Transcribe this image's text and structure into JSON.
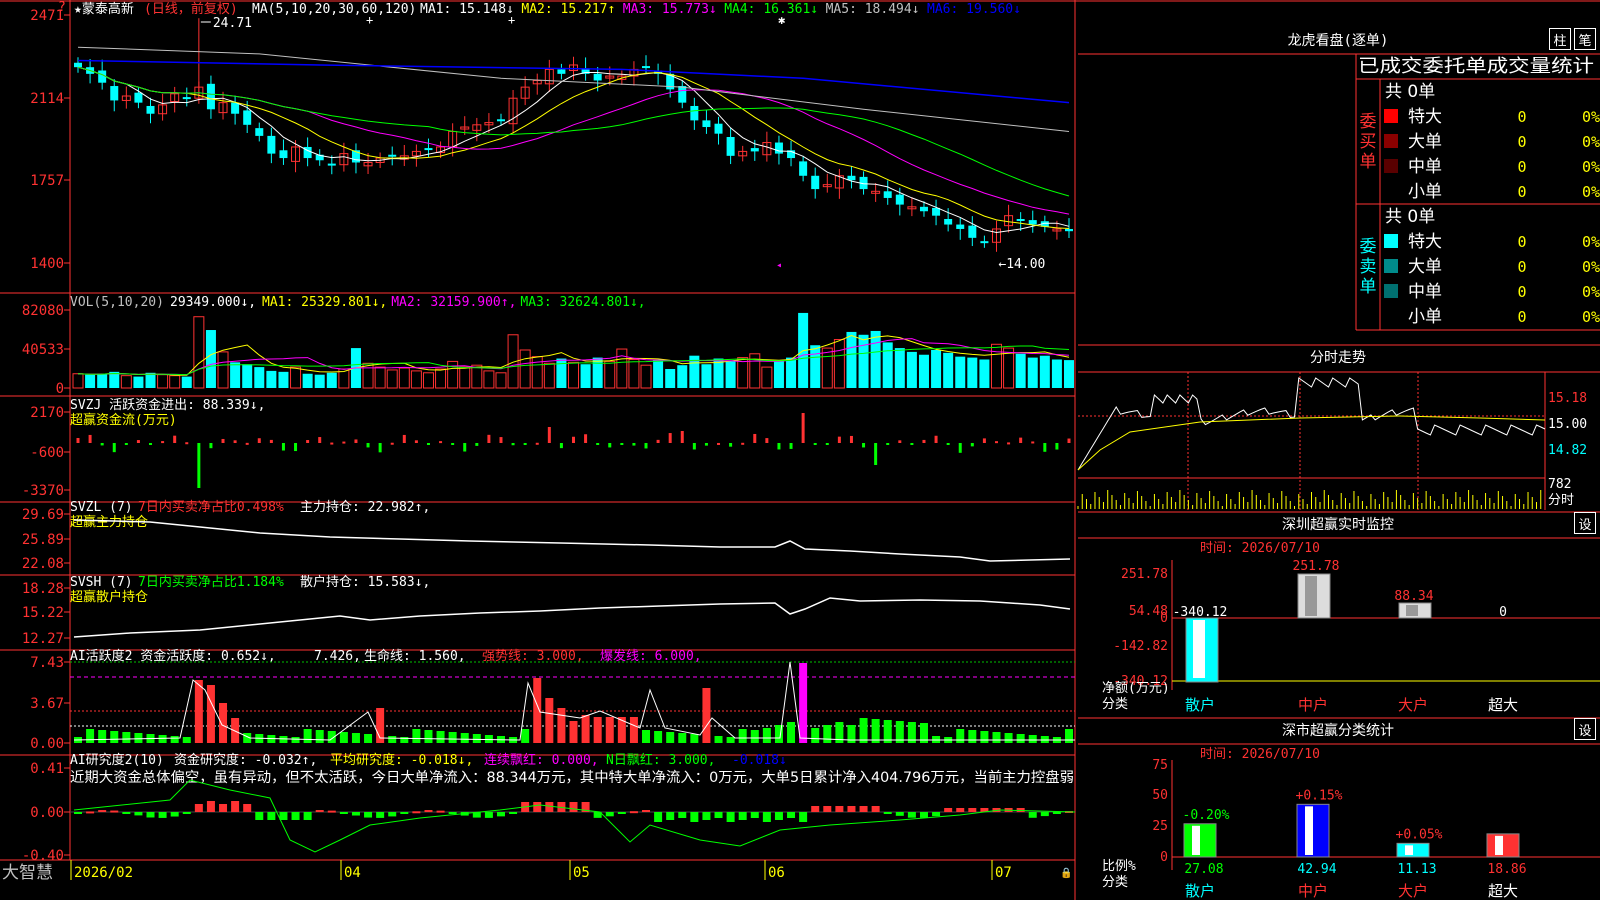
{
  "app": {
    "brand": "大智慧",
    "close_glyph": "?",
    "lock_glyph": "🔒"
  },
  "main": {
    "stock_name": "★蒙泰高新",
    "stock_mode": "(日线，前复权)",
    "ma_header": "MA(5,10,20,30,60,120)",
    "ma": [
      {
        "label": "MA1: 15.148",
        "arrow": "↓",
        "color": "#ffffff"
      },
      {
        "label": "MA2: 15.217",
        "arrow": "↑",
        "color": "#ffff00"
      },
      {
        "label": "MA3: 15.773",
        "arrow": "↓",
        "color": "#ff00ff"
      },
      {
        "label": "MA4: 16.361",
        "arrow": "↓",
        "color": "#00ff00"
      },
      {
        "label": "MA5: 18.494",
        "arrow": "↓",
        "color": "#c0c0c0"
      },
      {
        "label": "MA6: 19.560",
        "arrow": "↓",
        "color": "#0000ff"
      }
    ],
    "price_ticks": [
      "2471",
      "2114",
      "1757",
      "1400"
    ],
    "high_label": "24.71",
    "low_label": "←14.00"
  },
  "vol": {
    "header": "VOL(5,10,20)",
    "value": "29349.000",
    "ma": [
      {
        "label": "MA1: 25329.801",
        "arrow": "↓",
        "color": "#ffff00"
      },
      {
        "label": "MA2: 32159.900",
        "arrow": "↑",
        "color": "#ff00ff"
      },
      {
        "label": "MA3: 32624.801",
        "arrow": "↓",
        "color": "#00ff00"
      }
    ],
    "ticks": [
      "82080",
      "40533",
      "0"
    ]
  },
  "svzj": {
    "header": "SVZJ  活跃资金进出: 88.339",
    "sub": "超赢资金流(万元)",
    "ticks": [
      "2170",
      "-600",
      "-3370"
    ]
  },
  "svzl": {
    "header_a": "SVZL (7)",
    "header_b": "7日内买卖净占比0.498%",
    "header_c": "主力持仓: 22.982",
    "sub": "超赢主力持仓",
    "ticks": [
      "29.69",
      "25.89",
      "22.08"
    ]
  },
  "svsh": {
    "header_a": "SVSH (7)",
    "header_b": "7日内买卖净占比1.184%",
    "header_c": "散户持仓: 15.583",
    "sub": "超赢散户持仓",
    "ticks": [
      "18.28",
      "15.22",
      "12.27"
    ]
  },
  "ai1": {
    "header_a": "AI活跃度2 资金活跃度: 0.652",
    "header_b": "7.426,",
    "header_c": "生命线: 1.560,",
    "header_d": "强势线: 3.000,",
    "header_e": "爆发线: 6.000,",
    "ticks": [
      "7.43",
      "3.67",
      "0.00"
    ]
  },
  "ai2": {
    "header_a": "AI研究度2(10)",
    "header_b": "资金研究度: -0.032",
    "header_c": "平均研究度: -0.018",
    "header_d": "连续飘红: 0.000,",
    "header_e": "N日飘红: 3.000,",
    "header_f": "-0.018",
    "comment": "近期大资金总体偏空，虽有异动，但不太活跃，今日大单净流入：88.344万元，其中特大单净流入：0万元，大单5日累计净入404.796万元，当前主力控盘弱",
    "ticks": [
      "0.41",
      "0.00",
      "-0.40"
    ]
  },
  "xaxis": {
    "labels": [
      "2026/02",
      "04",
      "05",
      "06",
      "07"
    ]
  },
  "longhu": {
    "title": "龙虎看盘(逐单)",
    "tab_zhu": "柱",
    "tab_bi": "笔",
    "stat_title": "已成交委托单成交量统计",
    "buy_label": "委买单",
    "sell_label": "委卖单",
    "buy_total": "共 0单",
    "sell_total": "共 0单",
    "buy_rows": [
      {
        "name": "特大",
        "count": "0",
        "pct": "0%",
        "color": "#ff0000"
      },
      {
        "name": "大单",
        "count": "0",
        "pct": "0%",
        "color": "#8b0000"
      },
      {
        "name": "中单",
        "count": "0",
        "pct": "0%",
        "color": "#5a0000"
      },
      {
        "name": "小单",
        "count": "0",
        "pct": "0%",
        "color": ""
      }
    ],
    "sell_rows": [
      {
        "name": "特大",
        "count": "0",
        "pct": "0%",
        "color": "#00ffff"
      },
      {
        "name": "大单",
        "count": "0",
        "pct": "0%",
        "color": "#008b8b"
      },
      {
        "name": "中单",
        "count": "0",
        "pct": "0%",
        "color": "#007070"
      },
      {
        "name": "小单",
        "count": "0",
        "pct": "0%",
        "color": ""
      }
    ]
  },
  "intraday": {
    "title": "分时走势",
    "ticks": [
      "15.18",
      "15.00",
      "14.82"
    ],
    "vol_ticks": [
      "782",
      "分时"
    ]
  },
  "monitor": {
    "title": "深圳超赢实时监控",
    "settings": "设",
    "time": "时间: 2026/07/10",
    "ticks": [
      "251.78",
      "54.48",
      "0",
      "-142.82",
      "-340.12"
    ],
    "axis_title_1": "净额(万元)",
    "axis_title_2": "分类",
    "categories": [
      "散户",
      "中户",
      "大户",
      "超大"
    ],
    "bar_labels": [
      "-340.12",
      "251.78",
      "88.34",
      "0"
    ]
  },
  "classify": {
    "title": "深市超赢分类统计",
    "settings": "设",
    "time": "时间: 2026/07/10",
    "ticks": [
      "75",
      "50",
      "25",
      "0"
    ],
    "axis_title_1": "比例%",
    "axis_title_2": "分类",
    "categories": [
      "散户",
      "中户",
      "大户",
      "超大"
    ],
    "changes": [
      "-0.20%",
      "+0.15%",
      "+0.05%",
      ""
    ],
    "bottom_values": [
      "27.08",
      "42.94",
      "11.13",
      "18.86"
    ]
  },
  "chart_data": [
    {
      "type": "line",
      "title": "蒙泰高新 日线 candlestick",
      "ylim": [
        14.0,
        24.71
      ],
      "x": [
        "2026/02",
        "04",
        "05",
        "06",
        "07"
      ],
      "series": [
        {
          "name": "close",
          "values": [
            22.5,
            22.2,
            21.8,
            21.0,
            21.2,
            20.9,
            20.4,
            20.8,
            21.3,
            21.1,
            21.6,
            20.6,
            20.9,
            20.4,
            19.9,
            19.4,
            18.6,
            18.4,
            18.9,
            18.4,
            18.3,
            18.1,
            18.6,
            18.2,
            18.2,
            18.4,
            18.5,
            18.5,
            18.7,
            18.8,
            18.9,
            19.6,
            19.8,
            19.9,
            20.0,
            20.1,
            21.1,
            21.6,
            21.9,
            22.4,
            22.2,
            22.6,
            22.2,
            21.9,
            22.1,
            22.1,
            22.4,
            22.5,
            22.2,
            21.5,
            20.9,
            20.1,
            19.8,
            19.5,
            18.5,
            18.7,
            18.7,
            19.1,
            18.6,
            18.4,
            17.6,
            17.0,
            17.2,
            17.6,
            17.4,
            17.0,
            16.9,
            16.6,
            16.3,
            16.2,
            16.0,
            15.8,
            15.4,
            15.2,
            14.8,
            14.6,
            15.2,
            15.8,
            15.6,
            15.4,
            15.3,
            15.2,
            15.1
          ]
        }
      ]
    },
    {
      "type": "bar",
      "title": "VOL(5,10,20)",
      "ylim": [
        0,
        82080
      ],
      "series": [
        {
          "name": "VOL",
          "values": [
            15000,
            14000,
            15000,
            17000,
            13000,
            12000,
            16000,
            14000,
            13000,
            12000,
            75000,
            61000,
            38000,
            27000,
            25000,
            22000,
            18000,
            17000,
            22000,
            15000,
            14000,
            16000,
            20000,
            42000,
            26000,
            22000,
            19000,
            21000,
            18000,
            16000,
            20000,
            28000,
            22000,
            24000,
            18000,
            16000,
            56000,
            40000,
            33000,
            26000,
            31000,
            27000,
            25000,
            32000,
            28000,
            41000,
            30000,
            24000,
            30000,
            20000,
            24000,
            34000,
            25000,
            31000,
            28000,
            32000,
            36000,
            22000,
            28000,
            32000,
            79000,
            45000,
            42000,
            51000,
            59000,
            56000,
            60000,
            48000,
            42000,
            38000,
            35000,
            40000,
            37000,
            33000,
            32000,
            30000,
            46000,
            42000,
            36000,
            32000,
            34000,
            30000,
            29349
          ]
        }
      ]
    }
  ]
}
